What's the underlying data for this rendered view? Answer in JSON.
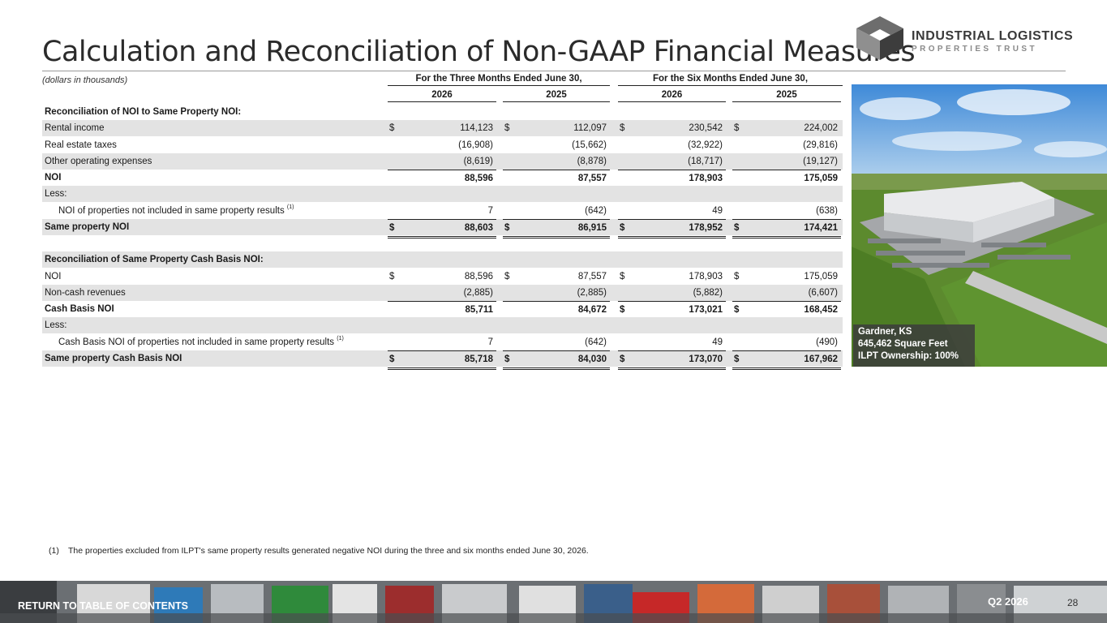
{
  "title": "Calculation and Reconciliation of Non-GAAP Financial Measures",
  "logo": {
    "line1": "INDUSTRIAL LOGISTICS",
    "line2": "PROPERTIES TRUST"
  },
  "units_note": "(dollars in thousands)",
  "period_headers": {
    "three_months": "For the Three Months Ended June 30,",
    "six_months": "For the Six Months Ended June 30,"
  },
  "years": [
    "2026",
    "2025",
    "2026",
    "2025"
  ],
  "currency_symbol": "$",
  "rows": [
    {
      "label": "Reconciliation of NOI to Same Property NOI:",
      "values": [
        "",
        "",
        "",
        ""
      ]
    },
    {
      "label": "Rental income",
      "values": [
        "114,123",
        "112,097",
        "230,542",
        "224,002"
      ]
    },
    {
      "label": "Real estate taxes",
      "values": [
        "(16,908)",
        "(15,662)",
        "(32,922)",
        "(29,816)"
      ]
    },
    {
      "label": "Other operating expenses",
      "values": [
        "(8,619)",
        "(8,878)",
        "(18,717)",
        "(19,127)"
      ]
    },
    {
      "label": "NOI",
      "values": [
        "88,596",
        "87,557",
        "178,903",
        "175,059"
      ]
    },
    {
      "label": "Less:",
      "values": [
        "",
        "",
        "",
        ""
      ]
    },
    {
      "label": "NOI of properties not included in same property results",
      "footnote_ref": "(1)",
      "values": [
        "7",
        "(642)",
        "49",
        "(638)"
      ]
    },
    {
      "label": "Same property NOI",
      "values": [
        "88,603",
        "86,915",
        "178,952",
        "174,421"
      ]
    },
    {
      "label": "",
      "values": [
        "",
        "",
        "",
        ""
      ]
    },
    {
      "label": "Reconciliation of Same Property Cash Basis NOI:",
      "values": [
        "",
        "",
        "",
        ""
      ]
    },
    {
      "label": "NOI",
      "values": [
        "88,596",
        "87,557",
        "178,903",
        "175,059"
      ]
    },
    {
      "label": "Non-cash revenues",
      "values": [
        "(2,885)",
        "(2,885)",
        "(5,882)",
        "(6,607)"
      ]
    },
    {
      "label": "Cash Basis NOI",
      "values": [
        "85,711",
        "84,672",
        "173,021",
        "168,452"
      ]
    },
    {
      "label": "Less:",
      "values": [
        "",
        "",
        "",
        ""
      ]
    },
    {
      "label": "Cash Basis NOI of properties not included in same property results",
      "footnote_ref": "(1)",
      "values": [
        "7",
        "(642)",
        "49",
        "(490)"
      ]
    },
    {
      "label": "Same property Cash Basis NOI",
      "values": [
        "85,718",
        "84,030",
        "173,070",
        "167,962"
      ]
    }
  ],
  "photo_caption": {
    "line1": "Gardner, KS",
    "line2": "645,462 Square Feet",
    "line3": "ILPT Ownership: 100%"
  },
  "footnote": {
    "number": "(1)",
    "text": "The properties excluded from ILPT's same property results generated negative NOI during the three and six months ended June 30, 2026."
  },
  "footer": {
    "return_link": "RETURN TO TABLE OF CONTENTS",
    "quarter": "Q2 2026",
    "page_number": "28"
  },
  "colors": {
    "row_shade": "#e3e3e3",
    "logo_gray": "#3a3a3a",
    "title_text": "#2b2b2b"
  }
}
